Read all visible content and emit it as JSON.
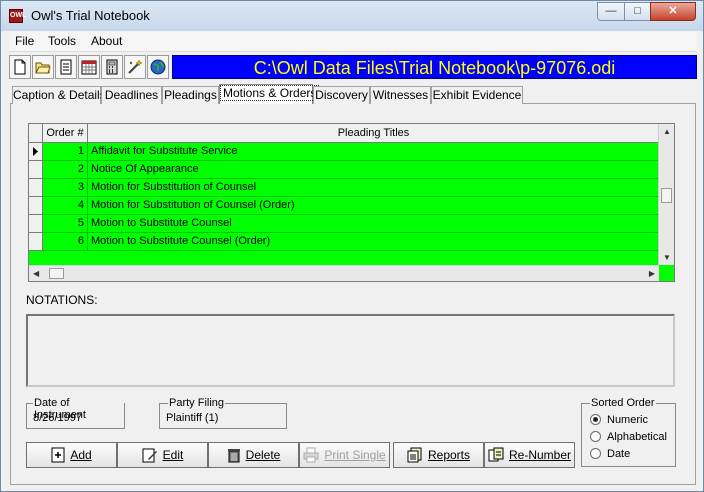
{
  "window": {
    "title": "Owl's Trial Notebook",
    "app_icon_text": "OWL",
    "controls": {
      "minimize": "—",
      "maximize": "□",
      "close": "✕"
    }
  },
  "menu": [
    "File",
    "Tools",
    "About"
  ],
  "toolbar": {
    "icons": [
      "new-file-icon",
      "open-folder-icon",
      "document-icon",
      "calendar-icon",
      "calculator-icon",
      "wizard-icon",
      "globe-icon"
    ],
    "path": "C:\\Owl Data Files\\Trial Notebook\\p-97076.odi"
  },
  "tabs": [
    "Caption & Details",
    "Deadlines",
    "Pleadings",
    "Motions & Orders",
    "Discovery",
    "Witnesses",
    "Exhibit Evidence"
  ],
  "active_tab": "Motions & Orders",
  "grid": {
    "columns": [
      "Order #",
      "Pleading Titles"
    ],
    "rows": [
      {
        "num": "1",
        "title": "Affidavit for Substitute Service"
      },
      {
        "num": "2",
        "title": "Notice Of Appearance"
      },
      {
        "num": "3",
        "title": "Motion for Substitution of Counsel"
      },
      {
        "num": "4",
        "title": "Motion for Substitution of Counsel (Order)"
      },
      {
        "num": "5",
        "title": "Motion to Substitute Counsel"
      },
      {
        "num": "6",
        "title": "Motion to Substitute Counsel (Order)"
      }
    ],
    "row_color": "#00ff00"
  },
  "notations": {
    "label": "NOTATIONS:",
    "value": ""
  },
  "date_of_instrument": {
    "label": "Date of Instrument",
    "value": "8/26/1997"
  },
  "party_filing": {
    "label": "Party Filing",
    "value": "Plaintiff (1)"
  },
  "sorted_order": {
    "label": "Sorted Order",
    "options": [
      "Numeric",
      "Alphabetical",
      "Date"
    ],
    "selected": "Numeric"
  },
  "buttons": {
    "add": "Add",
    "edit": "Edit",
    "delete": "Delete",
    "print_single": "Print Single",
    "reports": "Reports",
    "renumber": "Re-Number"
  }
}
